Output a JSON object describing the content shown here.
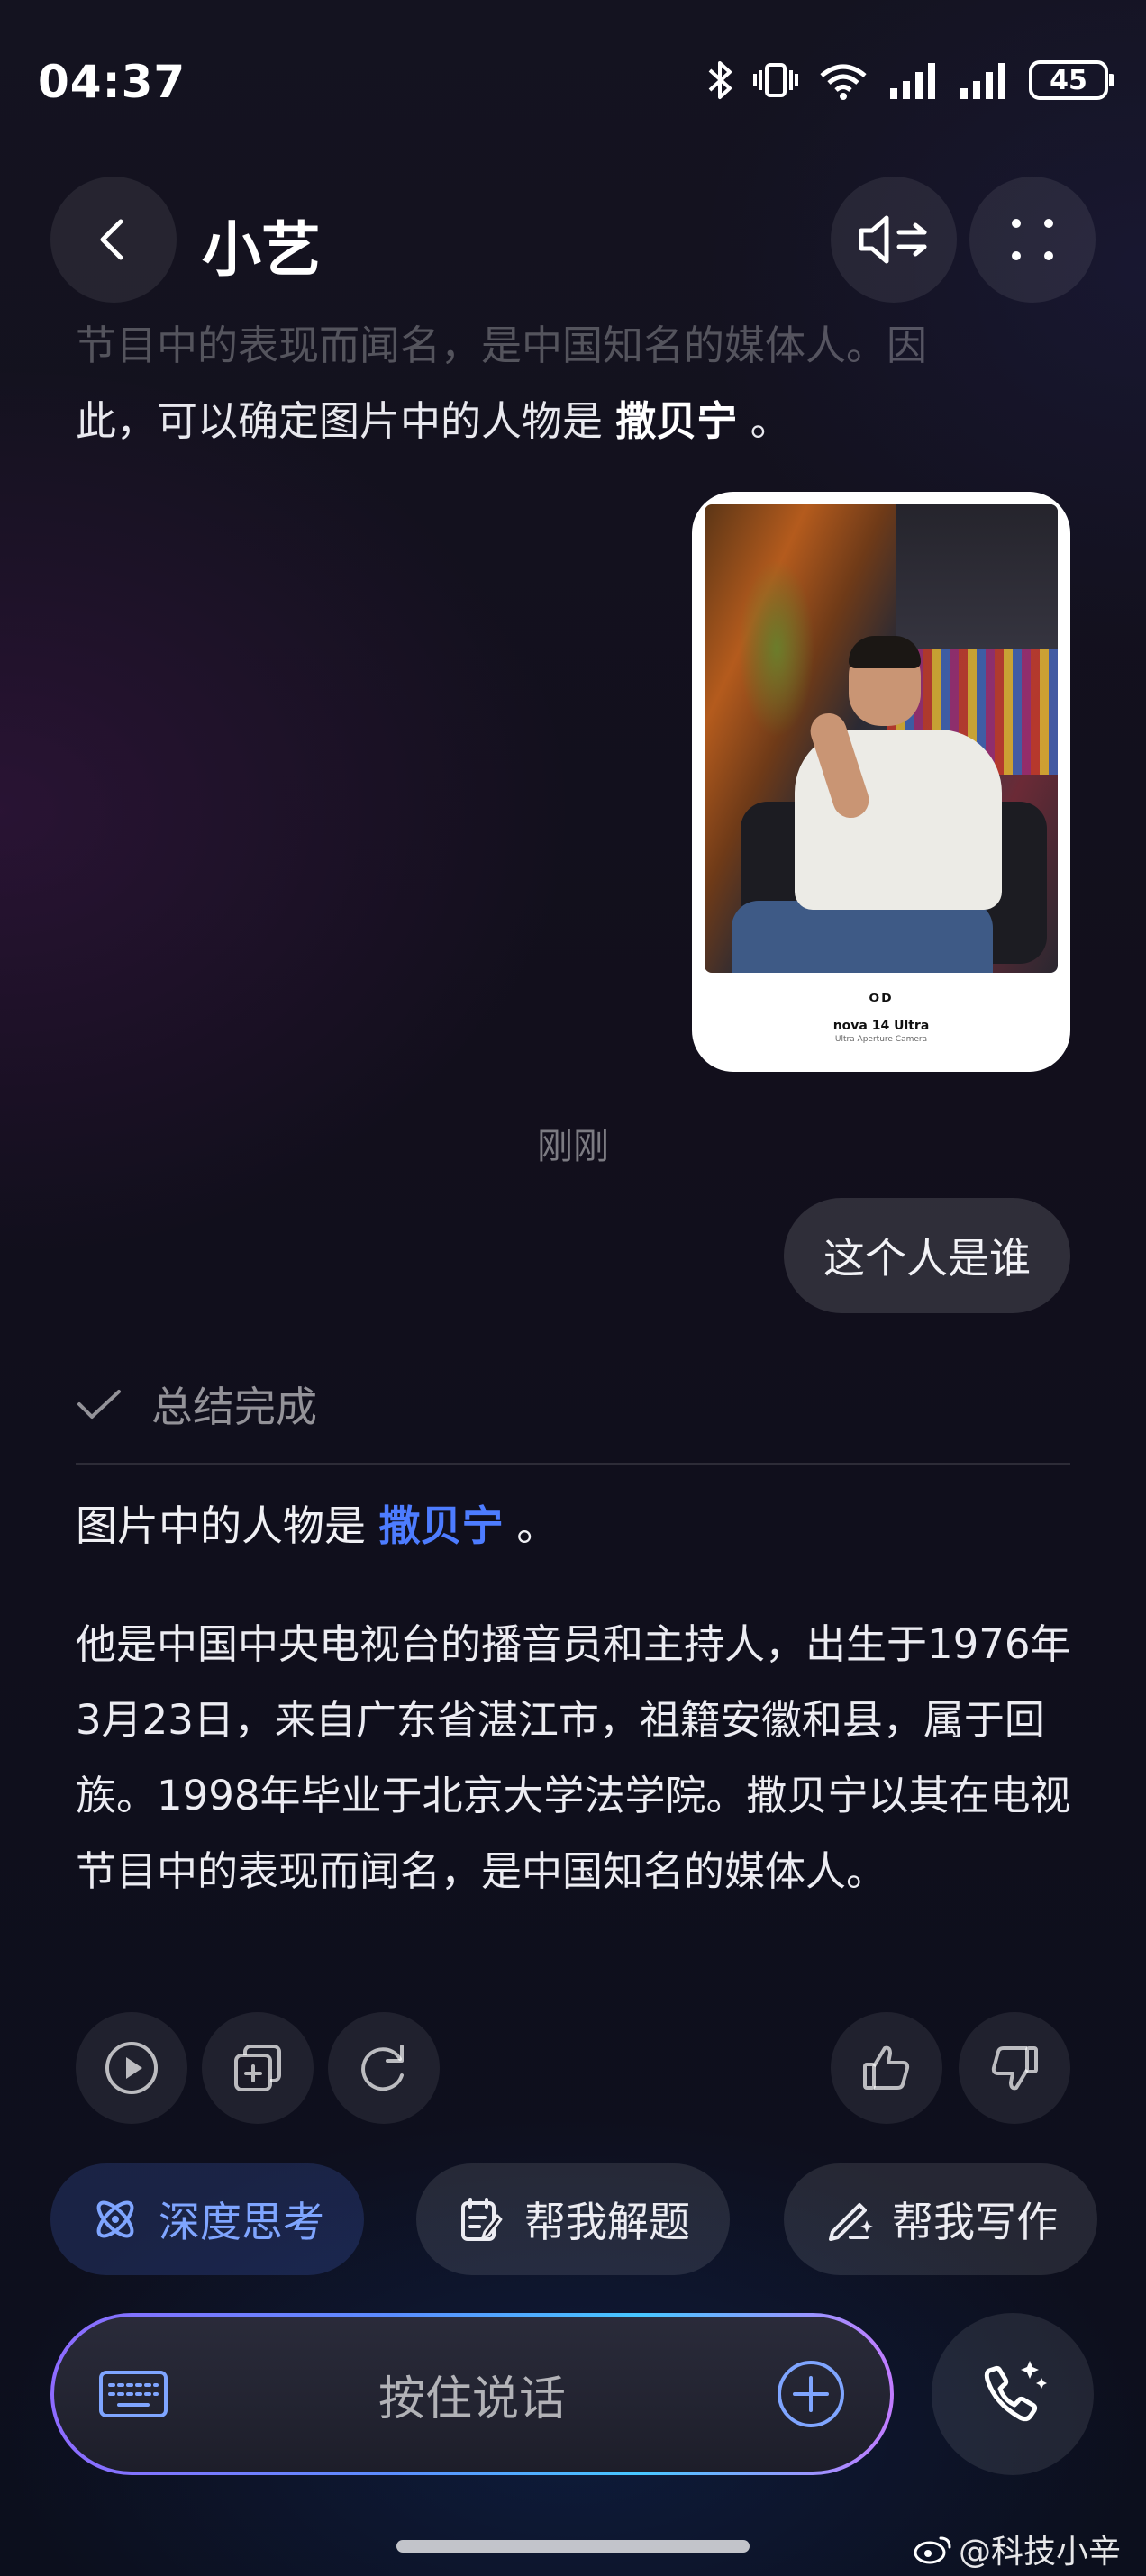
{
  "status_bar": {
    "time": "04:37",
    "battery": "45",
    "icons": [
      "bluetooth-icon",
      "vibrate-icon",
      "wifi-icon",
      "signal-icon",
      "signal-icon",
      "battery-icon"
    ]
  },
  "header": {
    "title": "小艺",
    "back_icon": "chevron-left-icon",
    "sound_icon": "speaker-icon",
    "more_icon": "grid-dots-icon"
  },
  "previous_message": {
    "line1": "节目中的表现而闻名，是中国知名的媒体人。因",
    "line2_prefix": "此，可以确定图片中的人物是 ",
    "line2_name": "撒贝宁",
    "line2_suffix": " 。"
  },
  "photo_card": {
    "brand": "nova 14 Ultra",
    "subtitle": "Ultra Aperture Camera",
    "logo": "ᴼᴰ"
  },
  "timestamp": "刚刚",
  "user_message": "这个人是谁",
  "summary_status": "总结完成",
  "answer": {
    "line1_prefix": "图片中的人物是 ",
    "person_name": "撒贝宁",
    "line1_suffix": " 。",
    "body": "他是中国中央电视台的播音员和主持人，出生于1976年3月23日，来自广东省湛江市，祖籍安徽和县，属于回族。1998年毕业于北京大学法学院。撒贝宁以其在电视节目中的表现而闻名，是中国知名的媒体人。"
  },
  "actions": [
    "play-icon",
    "copy-icon",
    "regenerate-icon",
    "thumbs-up-icon",
    "thumbs-down-icon"
  ],
  "chips": [
    {
      "label": "深度思考",
      "icon": "atom-icon"
    },
    {
      "label": "帮我解题",
      "icon": "edit-note-icon"
    },
    {
      "label": "帮我写作",
      "icon": "pen-sparkle-icon"
    }
  ],
  "input_bar": {
    "label": "按住说话",
    "keyboard_icon": "keyboard-icon",
    "add_icon": "plus-circle-icon"
  },
  "call_icon": "phone-sparkle-icon",
  "watermark": "@科技小辛",
  "colors": {
    "accent": "#4d7cff",
    "background": "#120f1c"
  }
}
